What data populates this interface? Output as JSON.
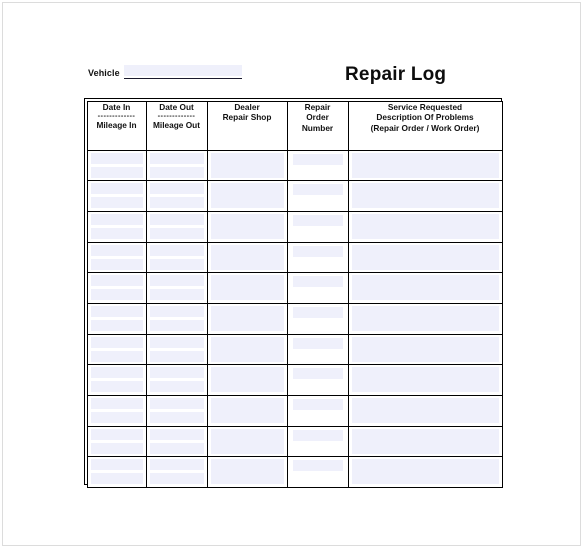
{
  "document": {
    "title": "Repair Log"
  },
  "header": {
    "vehicle_label": "Vehicle",
    "vehicle_value": "",
    "vehicle_placeholder": "",
    "title": "Repair Log"
  },
  "table": {
    "columns": [
      {
        "key": "date_in_mileage_in",
        "line1": "Date In",
        "divider": "-------------",
        "line2": "Mileage In",
        "field_style": "two-stacked"
      },
      {
        "key": "date_out_mileage_out",
        "line1": "Date Out",
        "divider": "-------------",
        "line2": "Mileage Out",
        "field_style": "two-stacked"
      },
      {
        "key": "dealer_repair_shop",
        "line1": "Dealer",
        "divider": "",
        "line2": "Repair Shop",
        "field_style": "single-large"
      },
      {
        "key": "repair_order_number",
        "line1": "Repair",
        "divider": "Order",
        "line2": "Number",
        "field_style": "single-top"
      },
      {
        "key": "service_requested",
        "line1": "Service Requested",
        "divider": "Description Of Problems",
        "line2": "(Repair Order / Work Order)",
        "field_style": "single-large"
      }
    ],
    "row_count": 11,
    "rows": [
      {
        "date_in": "",
        "mileage_in": "",
        "date_out": "",
        "mileage_out": "",
        "dealer_repair_shop": "",
        "repair_order_number": "",
        "service_requested": ""
      },
      {
        "date_in": "",
        "mileage_in": "",
        "date_out": "",
        "mileage_out": "",
        "dealer_repair_shop": "",
        "repair_order_number": "",
        "service_requested": ""
      },
      {
        "date_in": "",
        "mileage_in": "",
        "date_out": "",
        "mileage_out": "",
        "dealer_repair_shop": "",
        "repair_order_number": "",
        "service_requested": ""
      },
      {
        "date_in": "",
        "mileage_in": "",
        "date_out": "",
        "mileage_out": "",
        "dealer_repair_shop": "",
        "repair_order_number": "",
        "service_requested": ""
      },
      {
        "date_in": "",
        "mileage_in": "",
        "date_out": "",
        "mileage_out": "",
        "dealer_repair_shop": "",
        "repair_order_number": "",
        "service_requested": ""
      },
      {
        "date_in": "",
        "mileage_in": "",
        "date_out": "",
        "mileage_out": "",
        "dealer_repair_shop": "",
        "repair_order_number": "",
        "service_requested": ""
      },
      {
        "date_in": "",
        "mileage_in": "",
        "date_out": "",
        "mileage_out": "",
        "dealer_repair_shop": "",
        "repair_order_number": "",
        "service_requested": ""
      },
      {
        "date_in": "",
        "mileage_in": "",
        "date_out": "",
        "mileage_out": "",
        "dealer_repair_shop": "",
        "repair_order_number": "",
        "service_requested": ""
      },
      {
        "date_in": "",
        "mileage_in": "",
        "date_out": "",
        "mileage_out": "",
        "dealer_repair_shop": "",
        "repair_order_number": "",
        "service_requested": ""
      },
      {
        "date_in": "",
        "mileage_in": "",
        "date_out": "",
        "mileage_out": "",
        "dealer_repair_shop": "",
        "repair_order_number": "",
        "service_requested": ""
      },
      {
        "date_in": "",
        "mileage_in": "",
        "date_out": "",
        "mileage_out": "",
        "dealer_repair_shop": "",
        "repair_order_number": "",
        "service_requested": ""
      }
    ]
  },
  "colors": {
    "field_fill": "#eff0fb",
    "border": "#000000",
    "text": "#111111",
    "page_border": "#dcdcdc",
    "background": "#ffffff"
  }
}
